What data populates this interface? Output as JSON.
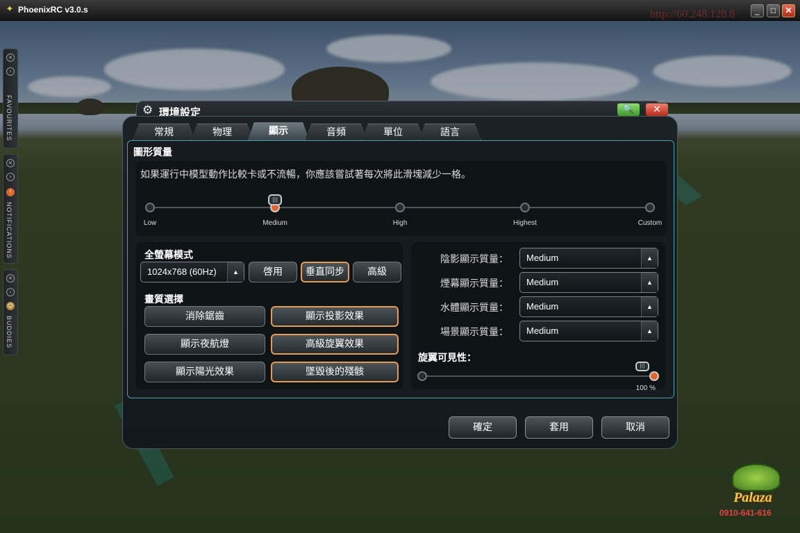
{
  "window": {
    "title": "PhoenixRC v3.0.s",
    "min": "_",
    "max": "□",
    "close": "✕"
  },
  "overlay": {
    "url": "http://60.248.128.8",
    "watermark": "PALAZA"
  },
  "sidebar": {
    "favourites": "FAVOURITES",
    "notifications": "NOTIFICATIONS",
    "buddies": "BUDDIES"
  },
  "logo": {
    "text": "Palaza",
    "phone": "0910-641-616"
  },
  "dialog": {
    "title": "環境設定",
    "tabs": [
      "常規",
      "物理",
      "顯示",
      "音頻",
      "單位",
      "語言"
    ],
    "active_tab": "顯示",
    "graphics": {
      "title": "圖形質量",
      "description": "如果運行中模型動作比較卡或不流暢，你應該嘗試著每次將此滑塊減少一格。",
      "levels": [
        "Low",
        "Medium",
        "High",
        "Highest",
        "Custom"
      ],
      "selected": "Medium"
    },
    "fullscreen": {
      "title": "全螢幕模式",
      "resolution": "1024x768 (60Hz)",
      "buttons": [
        "啓用",
        "垂直同步",
        "高級"
      ]
    },
    "quality": {
      "title": "畫質選擇",
      "options": [
        {
          "label": "消除鋸齒",
          "on": false
        },
        {
          "label": "顯示投影效果",
          "on": true
        },
        {
          "label": "顯示夜航燈",
          "on": false
        },
        {
          "label": "高級旋翼效果",
          "on": true
        },
        {
          "label": "顯示陽光效果",
          "on": false
        },
        {
          "label": "墜毀後的殘骸",
          "on": true
        }
      ]
    },
    "detail": {
      "rows": [
        {
          "label": "陰影顯示質量：",
          "value": "Medium"
        },
        {
          "label": "煙幕顯示質量：",
          "value": "Medium"
        },
        {
          "label": "水體顯示質量：",
          "value": "Medium"
        },
        {
          "label": "場景顯示質量：",
          "value": "Medium"
        }
      ],
      "rotor_title": "旋翼可見性：",
      "rotor_value": "100 %"
    },
    "footer": {
      "ok": "確定",
      "apply": "套用",
      "cancel": "取消"
    }
  }
}
